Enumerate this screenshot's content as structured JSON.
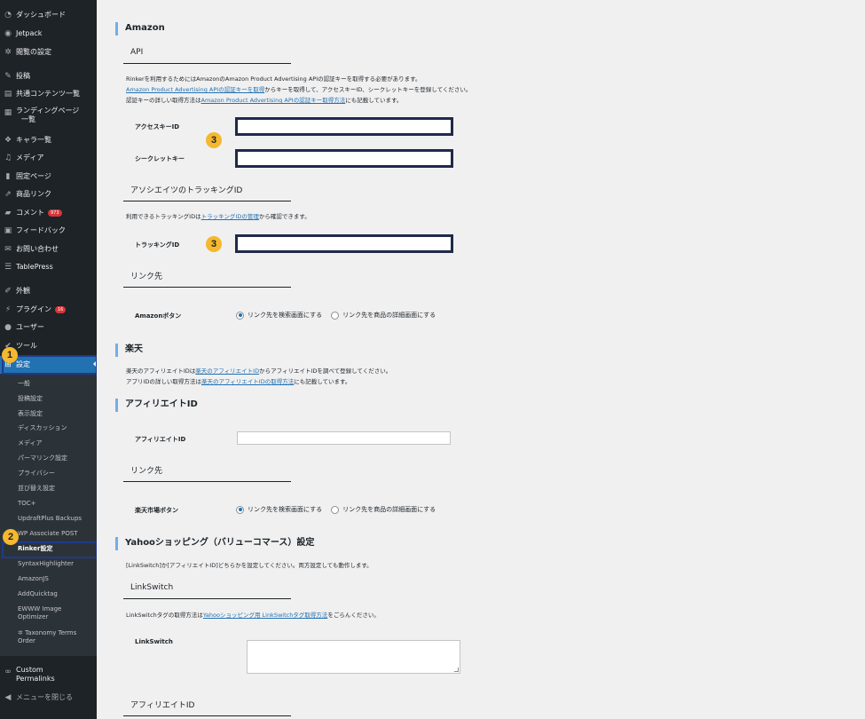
{
  "sidebar": {
    "items": [
      {
        "label": "ダッシュボード",
        "icon": "dashboard-icon"
      },
      {
        "label": "Jetpack",
        "icon": "jetpack-icon"
      },
      {
        "label": "閲覧の設定",
        "icon": "gear-icon"
      },
      {
        "label": "投稿",
        "icon": "pin-icon"
      },
      {
        "label": "共通コンテンツ一覧",
        "icon": "document-icon"
      },
      {
        "label": "ランディングページ",
        "label2": "一覧",
        "icon": "table-icon"
      },
      {
        "label": "キャラ一覧",
        "icon": "characters-icon"
      },
      {
        "label": "メディア",
        "icon": "media-icon"
      },
      {
        "label": "固定ページ",
        "icon": "page-icon"
      },
      {
        "label": "商品リンク",
        "icon": "link-icon"
      },
      {
        "label": "コメント",
        "icon": "comment-icon",
        "badge": "973"
      },
      {
        "label": "フィードバック",
        "icon": "feedback-icon"
      },
      {
        "label": "お問い合わせ",
        "icon": "mail-icon"
      },
      {
        "label": "TablePress",
        "icon": "tablepress-icon"
      },
      {
        "label": "外観",
        "icon": "brush-icon"
      },
      {
        "label": "プラグイン",
        "icon": "plugin-icon",
        "badge": "16"
      },
      {
        "label": "ユーザー",
        "icon": "user-icon"
      },
      {
        "label": "ツール",
        "icon": "wrench-icon"
      },
      {
        "label": "設定",
        "icon": "settings-icon"
      }
    ],
    "submenu": [
      "一般",
      "投稿設定",
      "表示設定",
      "ディスカッション",
      "メディア",
      "パーマリンク設定",
      "プライバシー",
      "並び替え設定",
      "TOC+",
      "UpdraftPlus Backups",
      "WP Associate POST",
      "Rinker設定",
      "SyntaxHighlighter",
      "AmazonJS",
      "AddQuicktag",
      "EWWW Image",
      "Optimizer",
      "Taxonomy Terms",
      "Order"
    ],
    "custom_permalinks": [
      "Custom",
      "Permalinks"
    ],
    "collapse": "メニューを閉じる"
  },
  "steps": [
    "1",
    "2",
    "3",
    "3"
  ],
  "colors": {
    "accent": "#2271b1",
    "sidebar": "#1d2327",
    "step_badge": "#f5b82e",
    "highlight_border": "#1f3a8a"
  },
  "amazon": {
    "title": "Amazon",
    "api_title": "API",
    "desc1": "Rinkerを利用するためにはAmazonのAmazon Product Advertising APIの認証キーを取得する必要があります。",
    "desc2_link": "Amazon Product Advertising APIの認証キーを取得",
    "desc2_rest": "からキーを取得して、アクセスキーID、シークレットキーを登録してください。",
    "desc3_pre": "認証キーの詳しい取得方法は",
    "desc3_link": "Amazon Product Advertising APIの認証キー取得方法",
    "desc3_post": "にも記載しています。",
    "access_key_label": "アクセスキーID",
    "secret_key_label": "シークレットキー",
    "tracking_title": "アソシエイツのトラッキングID",
    "tracking_desc_pre": "利用できるトラッキングIDは",
    "tracking_desc_link": "トラッキングIDの管理",
    "tracking_desc_post": "から確認できます。",
    "tracking_label": "トラッキングID",
    "link_title": "リンク先",
    "button_label": "Amazonボタン",
    "radio1": "リンク先を検索画面にする",
    "radio2": "リンク先を商品の詳細画面にする"
  },
  "rakuten": {
    "title": "楽天",
    "desc1_pre": "楽天のアフィリエイトIDは",
    "desc1_link": "楽天のアフィリエイトID",
    "desc1_post": "からアフィリエイトIDを調べて登録してください。",
    "desc2_pre": "アプリIDの詳しい取得方法は",
    "desc2_link": "楽天のアフィリエイトIDの取得方法",
    "desc2_post": "にも記載しています。",
    "affiliate_title": "アフィリエイトID",
    "affiliate_label": "アフィリエイトID",
    "link_title": "リンク先",
    "button_label": "楽天市場ボタン",
    "radio1": "リンク先を検索画面にする",
    "radio2": "リンク先を商品の詳細画面にする"
  },
  "yahoo": {
    "title": "Yahooショッピング（バリューコマース）設定",
    "desc1": "[LinkSwitch]か[アフィリエイトID]どちらかを設定してください。両方設定しても動作します。",
    "linkswitch_title": "LinkSwitch",
    "linkswitch_desc_pre": "LinkSwitchタグの取得方法は",
    "linkswitch_desc_link": "Yahooショッピング用 LinkSwitchタグ取得方法",
    "linkswitch_desc_post": "をごらんください。",
    "linkswitch_label": "LinkSwitch",
    "affiliate_title": "アフィリエイトID"
  }
}
